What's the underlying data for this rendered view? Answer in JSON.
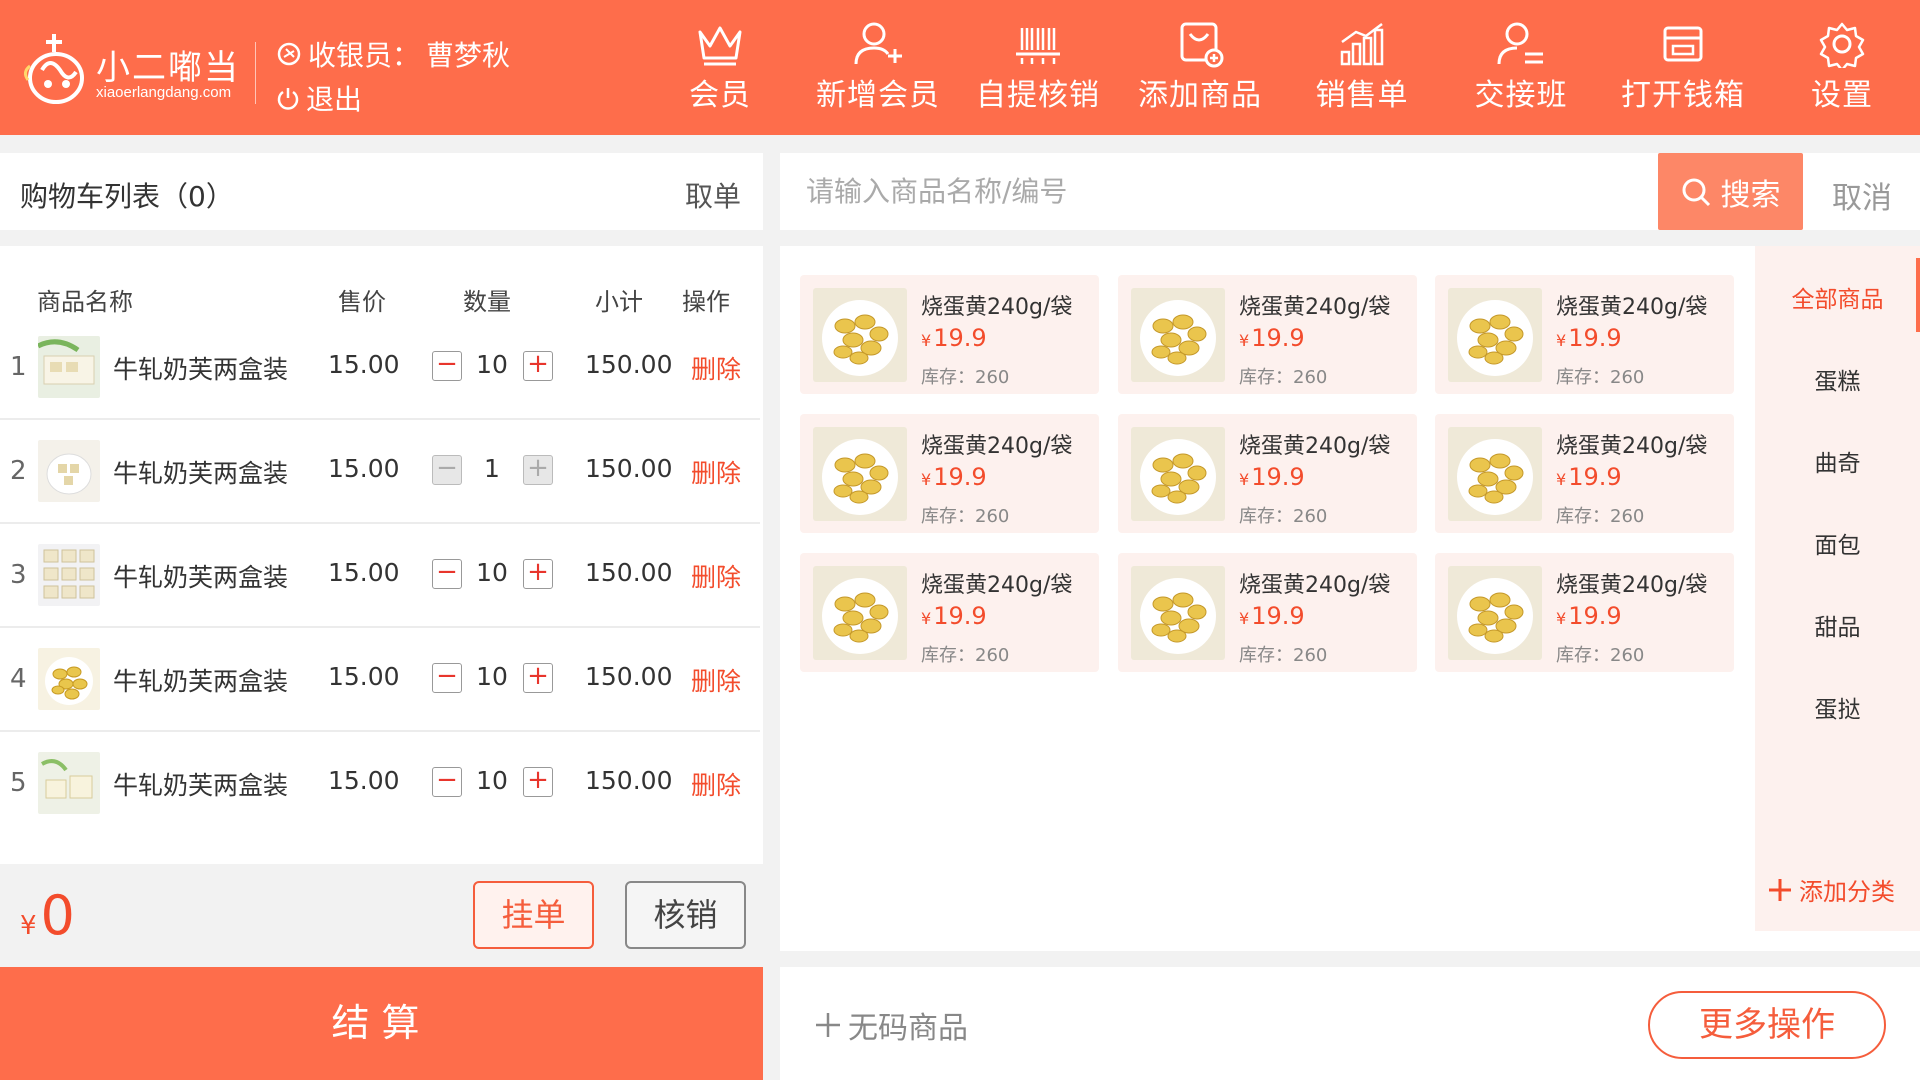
{
  "header": {
    "logo_name": "小二嘟当",
    "logo_domain": "xiaoerlangdang.com",
    "cashier_label": "收银员：",
    "cashier_name": "曹梦秋",
    "logout_label": "退出",
    "nav": [
      {
        "label": "会员",
        "icon": "crown-icon"
      },
      {
        "label": "新增会员",
        "icon": "add-user-icon"
      },
      {
        "label": "自提核销",
        "icon": "barcode-scan-icon"
      },
      {
        "label": "添加商品",
        "icon": "add-product-icon"
      },
      {
        "label": "销售单",
        "icon": "sales-chart-icon"
      },
      {
        "label": "交接班",
        "icon": "handover-icon"
      },
      {
        "label": "打开钱箱",
        "icon": "cash-drawer-icon"
      },
      {
        "label": "设置",
        "icon": "gear-icon"
      }
    ]
  },
  "cart": {
    "title": "购物车列表（0）",
    "cancel_label": "取单",
    "columns": [
      "商品名称",
      "售价",
      "数量",
      "小计",
      "操作"
    ],
    "items": [
      {
        "index": "1",
        "name": "牛轧奶芙两盒装",
        "price": "15.00",
        "qty": "10",
        "subtotal": "150.00",
        "action": "删除",
        "qty_enabled": true
      },
      {
        "index": "2",
        "name": "牛轧奶芙两盒装",
        "price": "15.00",
        "qty": "1",
        "subtotal": "150.00",
        "action": "删除",
        "qty_enabled": false
      },
      {
        "index": "3",
        "name": "牛轧奶芙两盒装",
        "price": "15.00",
        "qty": "10",
        "subtotal": "150.00",
        "action": "删除",
        "qty_enabled": true
      },
      {
        "index": "4",
        "name": "牛轧奶芙两盒装",
        "price": "15.00",
        "qty": "10",
        "subtotal": "150.00",
        "action": "删除",
        "qty_enabled": true
      },
      {
        "index": "5",
        "name": "牛轧奶芙两盒装",
        "price": "15.00",
        "qty": "10",
        "subtotal": "150.00",
        "action": "删除",
        "qty_enabled": true
      }
    ],
    "total_currency": "¥",
    "total_amount": "0",
    "hold_label": "挂单",
    "verify_label": "核销",
    "checkout_label": "结算"
  },
  "search": {
    "placeholder": "请输入商品名称/编号",
    "button_label": "搜索",
    "cancel_label": "取消"
  },
  "products": [
    {
      "name": "烧蛋黄240g/袋",
      "currency": "¥",
      "price": "19.9",
      "stock": "库存：260"
    },
    {
      "name": "烧蛋黄240g/袋",
      "currency": "¥",
      "price": "19.9",
      "stock": "库存：260"
    },
    {
      "name": "烧蛋黄240g/袋",
      "currency": "¥",
      "price": "19.9",
      "stock": "库存：260"
    },
    {
      "name": "烧蛋黄240g/袋",
      "currency": "¥",
      "price": "19.9",
      "stock": "库存：260"
    },
    {
      "name": "烧蛋黄240g/袋",
      "currency": "¥",
      "price": "19.9",
      "stock": "库存：260"
    },
    {
      "name": "烧蛋黄240g/袋",
      "currency": "¥",
      "price": "19.9",
      "stock": "库存：260"
    },
    {
      "name": "烧蛋黄240g/袋",
      "currency": "¥",
      "price": "19.9",
      "stock": "库存：260"
    },
    {
      "name": "烧蛋黄240g/袋",
      "currency": "¥",
      "price": "19.9",
      "stock": "库存：260"
    },
    {
      "name": "烧蛋黄240g/袋",
      "currency": "¥",
      "price": "19.9",
      "stock": "库存：260"
    }
  ],
  "categories": {
    "items": [
      "全部商品",
      "蛋糕",
      "曲奇",
      "面包",
      "甜品",
      "蛋挞"
    ],
    "active": "全部商品",
    "add_label": "添加分类"
  },
  "bottom": {
    "nocode_label": "无码商品",
    "more_label": "更多操作"
  },
  "colors": {
    "brand": "#fe6d4b",
    "accent_red": "#f34c2c",
    "card_bg": "#fdf1ee"
  }
}
